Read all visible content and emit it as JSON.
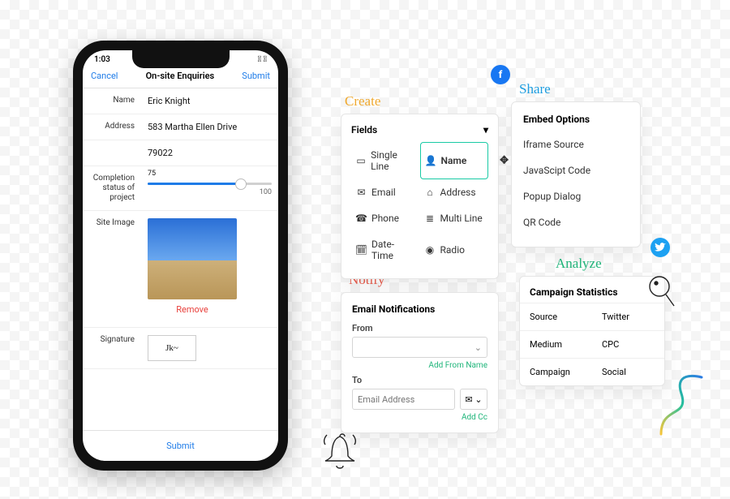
{
  "phone": {
    "time": "1:03",
    "nav": {
      "cancel": "Cancel",
      "title": "On-site Enquiries",
      "submit": "Submit"
    },
    "rows": {
      "name_label": "Name",
      "name_value": "Eric Knight",
      "address_label": "Address",
      "address_value": "583 Martha Ellen Drive",
      "zip_value": "79022",
      "completion_label": "Completion status of project",
      "slider_value": "75",
      "slider_max": "100",
      "siteimg_label": "Site Image",
      "remove": "Remove",
      "signature_label": "Signature"
    },
    "bottom_submit": "Submit"
  },
  "sections": {
    "create": "Create",
    "notify": "Notify",
    "share": "Share",
    "analyze": "Analyze"
  },
  "fields_card": {
    "title": "Fields",
    "items": {
      "single_line": "Single Line",
      "name": "Name",
      "email": "Email",
      "address": "Address",
      "phone": "Phone",
      "multi_line": "Multi Line",
      "date_time": "Date-Time",
      "radio": "Radio"
    }
  },
  "notify_card": {
    "title": "Email Notifications",
    "from_label": "From",
    "add_from": "Add From Name",
    "to_label": "To",
    "to_placeholder": "Email Address",
    "add_cc": "Add Cc"
  },
  "share_card": {
    "title": "Embed Options",
    "options": {
      "iframe": "Iframe Source",
      "js": "JavaScipt Code",
      "popup": "Popup Dialog",
      "qr": "QR Code"
    }
  },
  "analyze_card": {
    "title": "Campaign Statistics",
    "rows": {
      "source_k": "Source",
      "source_v": "Twitter",
      "medium_k": "Medium",
      "medium_v": "CPC",
      "campaign_k": "Campaign",
      "campaign_v": "Social"
    }
  }
}
